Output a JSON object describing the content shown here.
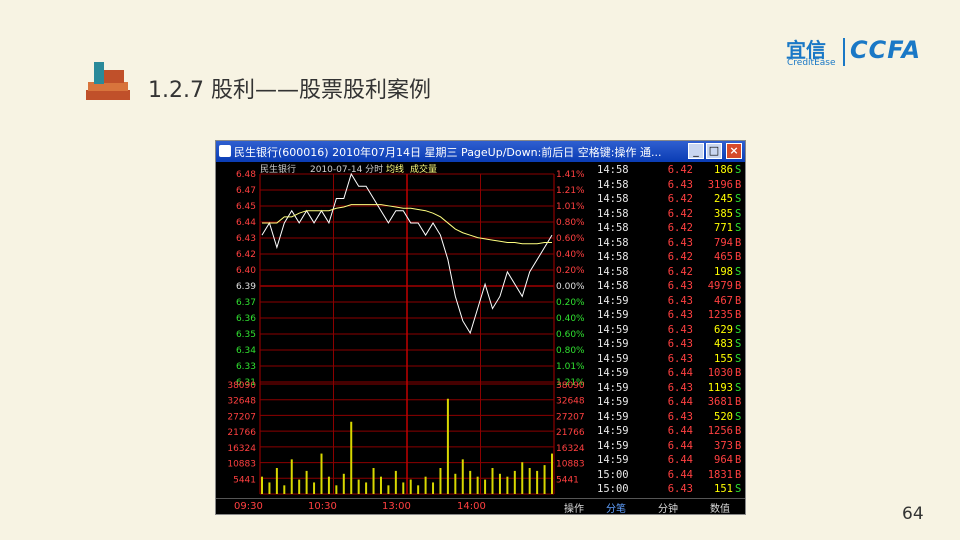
{
  "slide": {
    "title": "1.2.7 股利——股票股利案例",
    "page_number": "64",
    "logo": {
      "cn": "宜信",
      "en": "CreditEase",
      "right": "CCFA"
    }
  },
  "window": {
    "title": "民生银行(600016) 2010年07月14日 星期三 PageUp/Down:前后日 空格键:操作 通...",
    "min_label": "_",
    "max_label": "□",
    "close_label": "×"
  },
  "chart_data": {
    "type": "line",
    "header": {
      "name": "民生银行",
      "date": "2010-07-14 分时",
      "avg": "均线",
      "vol": "成交量"
    },
    "prev_close": "6.39",
    "price_ticks": [
      "6.48",
      "6.47",
      "6.45",
      "6.44",
      "6.43",
      "6.42",
      "6.40",
      "6.39",
      "6.37",
      "6.36",
      "6.35",
      "6.34",
      "6.33",
      "6.31"
    ],
    "pct_ticks": [
      "1.41%",
      "1.21%",
      "1.01%",
      "0.80%",
      "0.60%",
      "0.40%",
      "0.20%",
      "0.00%",
      "0.20%",
      "0.40%",
      "0.60%",
      "0.80%",
      "1.01%",
      "1.21%"
    ],
    "vol_ticks": [
      "38090",
      "32648",
      "27207",
      "21766",
      "16324",
      "10883",
      "5441"
    ],
    "time_ticks": [
      "09:30",
      "10:30",
      "13:00",
      "14:00"
    ],
    "ylim": [
      6.31,
      6.48
    ],
    "price_line": [
      6.43,
      6.44,
      6.42,
      6.44,
      6.45,
      6.44,
      6.45,
      6.44,
      6.45,
      6.44,
      6.46,
      6.46,
      6.48,
      6.47,
      6.47,
      6.46,
      6.45,
      6.44,
      6.45,
      6.45,
      6.44,
      6.44,
      6.43,
      6.44,
      6.43,
      6.41,
      6.38,
      6.36,
      6.35,
      6.37,
      6.39,
      6.37,
      6.38,
      6.4,
      6.39,
      6.38,
      6.4,
      6.41,
      6.42,
      6.43
    ],
    "avg_line": [
      6.44,
      6.44,
      6.44,
      6.445,
      6.445,
      6.448,
      6.45,
      6.45,
      6.45,
      6.45,
      6.452,
      6.453,
      6.455,
      6.455,
      6.455,
      6.455,
      6.455,
      6.454,
      6.453,
      6.452,
      6.452,
      6.451,
      6.45,
      6.448,
      6.445,
      6.44,
      6.435,
      6.432,
      6.43,
      6.428,
      6.427,
      6.426,
      6.425,
      6.424,
      6.424,
      6.423,
      6.423,
      6.423,
      6.424,
      6.424
    ],
    "volume": [
      6000,
      4000,
      9000,
      3000,
      12000,
      5000,
      8000,
      4000,
      14000,
      6000,
      3000,
      7000,
      25000,
      5000,
      4000,
      9000,
      6000,
      3000,
      8000,
      4000,
      5000,
      3000,
      6000,
      4000,
      9000,
      33000,
      7000,
      12000,
      8000,
      6000,
      5000,
      9000,
      7000,
      6000,
      8000,
      11000,
      9000,
      8000,
      10000,
      14000
    ]
  },
  "tape": [
    {
      "time": "14:58",
      "price": "6.42",
      "vol": "186",
      "side": "S"
    },
    {
      "time": "14:58",
      "price": "6.43",
      "vol": "3196",
      "side": "B"
    },
    {
      "time": "14:58",
      "price": "6.42",
      "vol": "245",
      "side": "S"
    },
    {
      "time": "14:58",
      "price": "6.42",
      "vol": "385",
      "side": "S"
    },
    {
      "time": "14:58",
      "price": "6.42",
      "vol": "771",
      "side": "S"
    },
    {
      "time": "14:58",
      "price": "6.43",
      "vol": "794",
      "side": "B"
    },
    {
      "time": "14:58",
      "price": "6.42",
      "vol": "465",
      "side": "B"
    },
    {
      "time": "14:58",
      "price": "6.42",
      "vol": "198",
      "side": "S"
    },
    {
      "time": "14:58",
      "price": "6.43",
      "vol": "4979",
      "side": "B"
    },
    {
      "time": "14:59",
      "price": "6.43",
      "vol": "467",
      "side": "B"
    },
    {
      "time": "14:59",
      "price": "6.43",
      "vol": "1235",
      "side": "B"
    },
    {
      "time": "14:59",
      "price": "6.43",
      "vol": "629",
      "side": "S"
    },
    {
      "time": "14:59",
      "price": "6.43",
      "vol": "483",
      "side": "S"
    },
    {
      "time": "14:59",
      "price": "6.43",
      "vol": "155",
      "side": "S"
    },
    {
      "time": "14:59",
      "price": "6.44",
      "vol": "1030",
      "side": "B"
    },
    {
      "time": "14:59",
      "price": "6.43",
      "vol": "1193",
      "side": "S"
    },
    {
      "time": "14:59",
      "price": "6.44",
      "vol": "3681",
      "side": "B"
    },
    {
      "time": "14:59",
      "price": "6.43",
      "vol": "520",
      "side": "S"
    },
    {
      "time": "14:59",
      "price": "6.44",
      "vol": "1256",
      "side": "B"
    },
    {
      "time": "14:59",
      "price": "6.44",
      "vol": "373",
      "side": "B"
    },
    {
      "time": "14:59",
      "price": "6.44",
      "vol": "964",
      "side": "B"
    },
    {
      "time": "15:00",
      "price": "6.44",
      "vol": "1831",
      "side": "B"
    },
    {
      "time": "15:00",
      "price": "6.43",
      "vol": "151",
      "side": "S"
    }
  ],
  "tabs": [
    "操作",
    "分笔",
    "分钟",
    "数值"
  ],
  "colors": {
    "up": "#ff4040",
    "down": "#30e030",
    "grid": "#8b0000",
    "avg": "#ffff80",
    "vol": "#d8d800"
  }
}
